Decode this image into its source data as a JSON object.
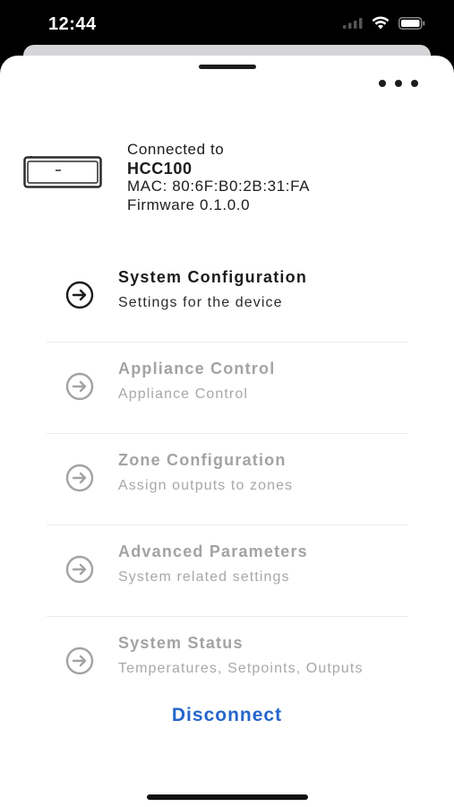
{
  "status_bar": {
    "time": "12:44",
    "icons": [
      "signal-icon",
      "wifi-icon",
      "battery-icon"
    ]
  },
  "header": {
    "more_icon": "ellipsis-icon"
  },
  "device": {
    "connected_label": "Connected to",
    "name": "HCC100",
    "mac": "MAC: 80:6F:B0:2B:31:FA",
    "firmware": "Firmware 0.1.0.0"
  },
  "menu": {
    "items": [
      {
        "title": "System Configuration",
        "subtitle": "Settings for the device",
        "enabled": true
      },
      {
        "title": "Appliance Control",
        "subtitle": "Appliance Control",
        "enabled": false
      },
      {
        "title": "Zone Configuration",
        "subtitle": "Assign outputs to zones",
        "enabled": false
      },
      {
        "title": "Advanced Parameters",
        "subtitle": "System related settings",
        "enabled": false
      },
      {
        "title": "System Status",
        "subtitle": "Temperatures, Setpoints, Outputs",
        "enabled": false
      }
    ]
  },
  "footer": {
    "disconnect_label": "Disconnect"
  },
  "colors": {
    "accent": "#2466cc",
    "enabled_text": "#1c1c1e",
    "disabled_text": "#a3a3a6"
  }
}
